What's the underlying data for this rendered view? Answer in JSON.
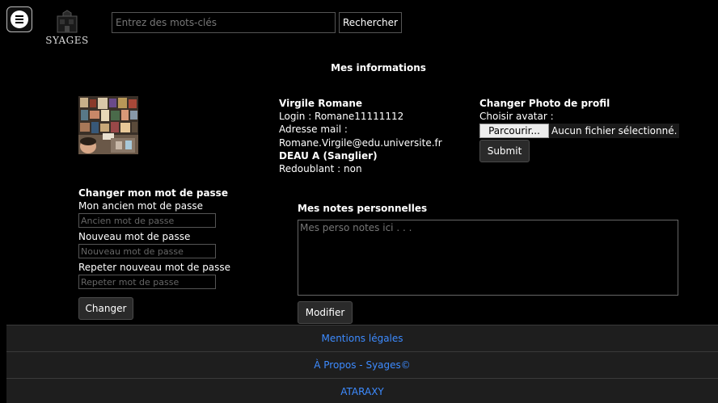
{
  "header": {
    "logo_text": "SYAGES",
    "search": {
      "placeholder": "Entrez des mots-clés",
      "button_label": "Rechercher"
    }
  },
  "page_title": "Mes informations",
  "user": {
    "name": "Virgile Romane",
    "login": "Login : Romane11111112",
    "email_label": "Adresse mail :",
    "email": "Romane.Virgile@edu.universite.fr",
    "program": "DEAU A (Sanglier)",
    "repeating": "Redoublant : non"
  },
  "photo": {
    "title": "Changer Photo de profil",
    "choose_label": "Choisir avatar :",
    "browse_label": "Parcourir...",
    "no_file": "Aucun fichier sélectionné.",
    "submit_label": "Submit"
  },
  "password": {
    "title": "Changer mon mot de passe",
    "old_label": "Mon ancien mot de passe",
    "old_placeholder": "Ancien mot de passe",
    "new_label": "Nouveau mot de passe",
    "new_placeholder": "Nouveau mot de passe",
    "repeat_label": "Repeter nouveau mot de passe",
    "repeat_placeholder": "Repeter mot de passe",
    "button_label": "Changer"
  },
  "notes": {
    "title": "Mes notes personnelles",
    "placeholder": "Mes perso notes ici . . .",
    "button_label": "Modifier"
  },
  "footer": {
    "legal": "Mentions légales",
    "about": "À Propos - Syages©",
    "ataraxy": "ATARAXY"
  },
  "colors": {
    "background": "#000000",
    "link": "#3d8bff",
    "footer_bg": "#1e1e1e"
  },
  "icons": {
    "menu": "hamburger-menu-icon"
  }
}
